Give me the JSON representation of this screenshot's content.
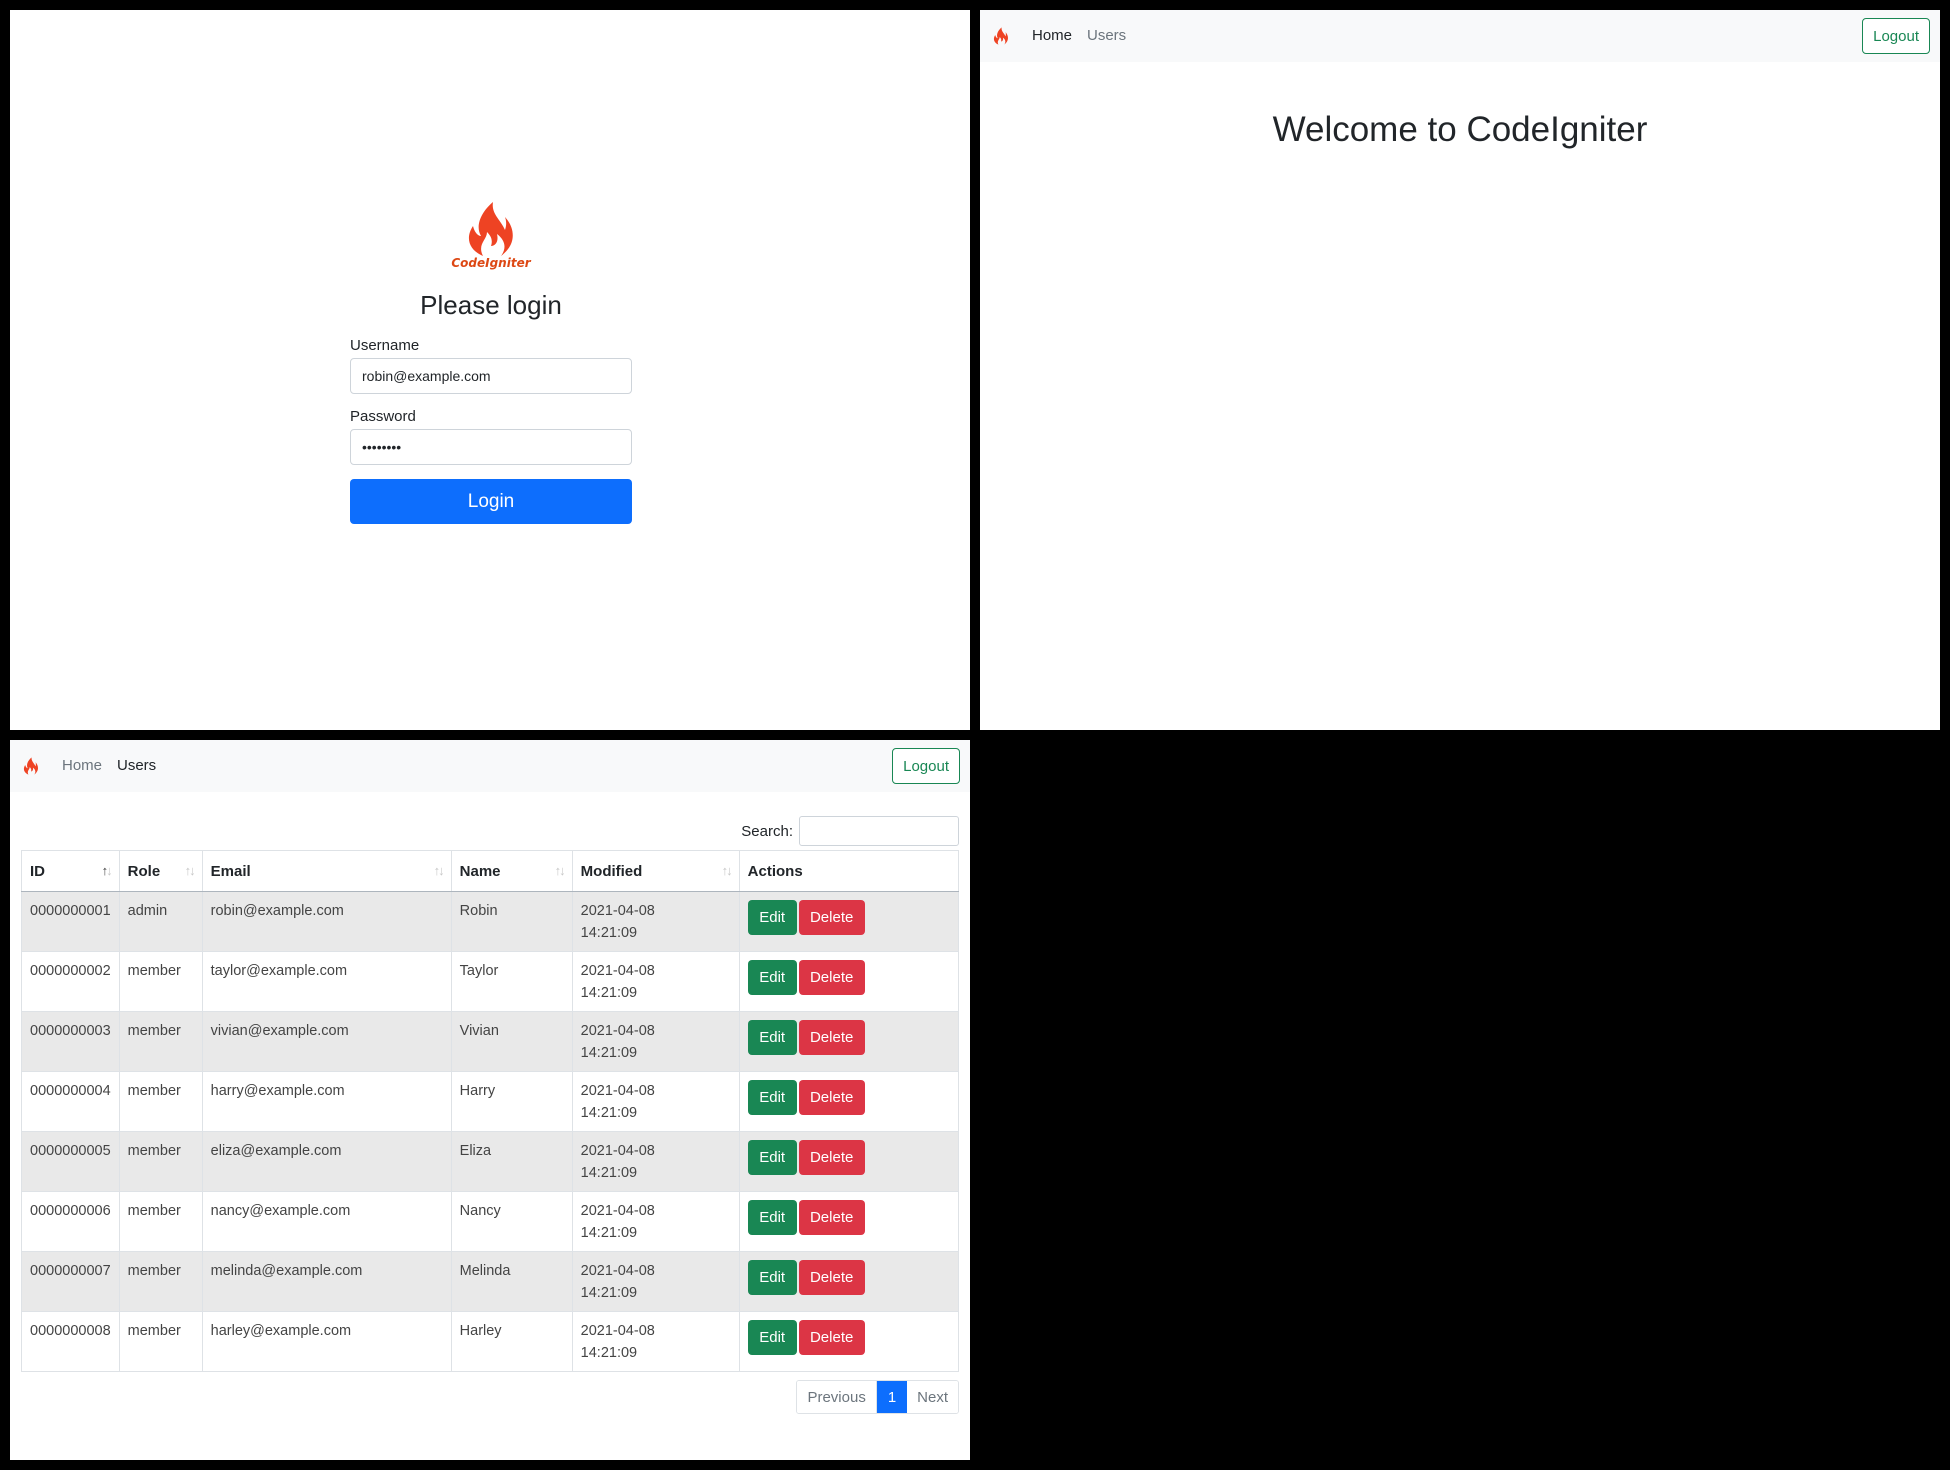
{
  "login": {
    "logo_caption": "CodeIgniter",
    "title": "Please login",
    "username_label": "Username",
    "username_value": "robin@example.com",
    "password_label": "Password",
    "password_value": "••••••••",
    "login_button": "Login"
  },
  "nav": {
    "home": "Home",
    "users": "Users",
    "logout": "Logout"
  },
  "home": {
    "heading": "Welcome to CodeIgniter"
  },
  "users_page": {
    "search_label": "Search:",
    "columns": [
      "ID",
      "Role",
      "Email",
      "Name",
      "Modified",
      "Actions"
    ],
    "edit_label": "Edit",
    "delete_label": "Delete",
    "rows": [
      {
        "id": "0000000001",
        "role": "admin",
        "email": "robin@example.com",
        "name": "Robin",
        "date": "2021-04-08",
        "time": "14:21:09"
      },
      {
        "id": "0000000002",
        "role": "member",
        "email": "taylor@example.com",
        "name": "Taylor",
        "date": "2021-04-08",
        "time": "14:21:09"
      },
      {
        "id": "0000000003",
        "role": "member",
        "email": "vivian@example.com",
        "name": "Vivian",
        "date": "2021-04-08",
        "time": "14:21:09"
      },
      {
        "id": "0000000004",
        "role": "member",
        "email": "harry@example.com",
        "name": "Harry",
        "date": "2021-04-08",
        "time": "14:21:09"
      },
      {
        "id": "0000000005",
        "role": "member",
        "email": "eliza@example.com",
        "name": "Eliza",
        "date": "2021-04-08",
        "time": "14:21:09"
      },
      {
        "id": "0000000006",
        "role": "member",
        "email": "nancy@example.com",
        "name": "Nancy",
        "date": "2021-04-08",
        "time": "14:21:09"
      },
      {
        "id": "0000000007",
        "role": "member",
        "email": "melinda@example.com",
        "name": "Melinda",
        "date": "2021-04-08",
        "time": "14:21:09"
      },
      {
        "id": "0000000008",
        "role": "member",
        "email": "harley@example.com",
        "name": "Harley",
        "date": "2021-04-08",
        "time": "14:21:09"
      }
    ],
    "pagination": {
      "previous": "Previous",
      "current": "1",
      "next": "Next"
    }
  },
  "colors": {
    "primary": "#0d6efd",
    "success": "#198754",
    "danger": "#dc3545",
    "brand": "#dd4814",
    "navbar_bg": "#f8f9fa"
  },
  "icons": {
    "logo": "codeigniter-flame-icon",
    "sort": "sort-arrows-icon"
  }
}
